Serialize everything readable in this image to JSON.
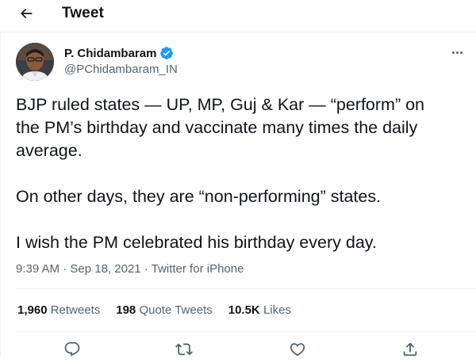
{
  "header": {
    "title": "Tweet",
    "back_icon": "arrow-left-icon"
  },
  "author": {
    "name": "P. Chidambaram",
    "handle": "@PChidambaram_IN",
    "verified_icon": "verified-badge-icon",
    "verified_color": "#1d9bf0"
  },
  "tweet": {
    "lines": [
      "BJP ruled states — UP, MP, Guj & Kar — “perform” on",
      "the PM’s birthday and vaccinate many times the daily",
      "average.",
      "On other days, they are “non-performing” states.",
      "I wish the PM celebrated his birthday every day."
    ],
    "time": "9:39 AM",
    "date": "Sep 18, 2021",
    "source": "Twitter for iPhone",
    "separator": "·"
  },
  "stats": {
    "retweets_count": "1,960",
    "retweets_label": "Retweets",
    "quotes_count": "198",
    "quotes_label": "Quote Tweets",
    "likes_count": "10.5K",
    "likes_label": "Likes"
  },
  "actions": [
    "reply-icon",
    "retweet-icon",
    "like-icon",
    "share-icon"
  ],
  "colors": {
    "text": "#0f1419",
    "secondary": "#536471",
    "border": "#eff3f4"
  }
}
